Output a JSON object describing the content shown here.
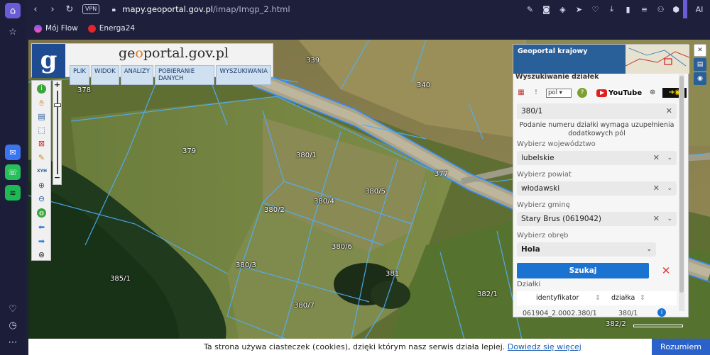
{
  "browser": {
    "url_host": "mapy.geoportal.gov.pl",
    "url_path": "/imap/Imgp_2.html",
    "vpn_label": "VPN",
    "ai_label": "AI",
    "bookmarks": [
      {
        "label": "Mój Flow",
        "icon": "flow-icon"
      },
      {
        "label": "Energa24",
        "icon": "energa-icon"
      }
    ]
  },
  "geoportal": {
    "logo_text_pre": "ge",
    "logo_text_o": "o",
    "logo_text_post": "portal.gov.pl",
    "logo_letter": "g",
    "menu": [
      "PLIK",
      "WIDOK",
      "ANALIZY",
      "POBIERANIE DANYCH",
      "WYSZUKIWANIA"
    ],
    "tool_label_xyh": "XYH"
  },
  "map_labels": [
    {
      "text": "339"
    },
    {
      "text": "378"
    },
    {
      "text": "340"
    },
    {
      "text": "379"
    },
    {
      "text": "380/1"
    },
    {
      "text": "377"
    },
    {
      "text": "380/5"
    },
    {
      "text": "380/4"
    },
    {
      "text": "380/2"
    },
    {
      "text": "380/6"
    },
    {
      "text": "380/3"
    },
    {
      "text": "381"
    },
    {
      "text": "385/1"
    },
    {
      "text": "382/1"
    },
    {
      "text": "380/7"
    },
    {
      "text": "382/2"
    }
  ],
  "panel": {
    "header_title": "Geoportal krajowy",
    "search_title": "Wyszukiwanie działek",
    "lang_value": "pol",
    "youtube_label": "YouTube",
    "parcel_value": "380/1",
    "info_text": "Podanie numeru działki wymaga uzupełnienia dodatkowych pól",
    "voivodeship_label": "Wybierz województwo",
    "voivodeship_value": "lubelskie",
    "county_label": "Wybierz powiat",
    "county_value": "włodawski",
    "commune_label": "Wybierz gminę",
    "commune_value": "Stary Brus (0619042)",
    "precinct_label": "Wybierz obręb",
    "precinct_value": "Hola",
    "search_button": "Szukaj",
    "results_label": "Działki",
    "col_id": "identyfikator",
    "col_parcel": "działka",
    "row_id": "061904_2.0002.380/1",
    "row_parcel": "380/1"
  },
  "cookie": {
    "text": "Ta strona używa ciasteczek (cookies), dzięki którym nasz serwis działa lepiej.",
    "link": "Dowiedz się więcej",
    "button": "Rozumiem"
  }
}
